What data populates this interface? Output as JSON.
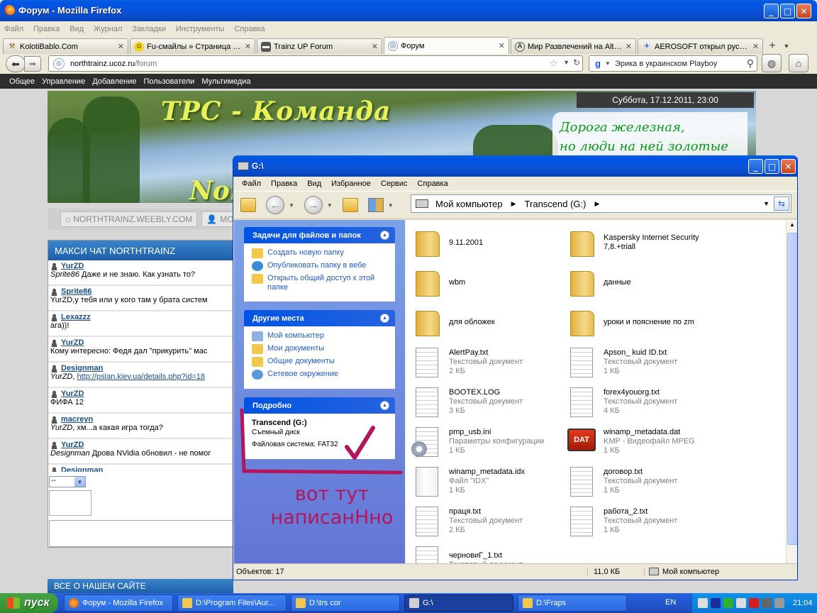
{
  "firefox": {
    "title": "Форум - Mozilla Firefox",
    "menu": [
      "Файл",
      "Правка",
      "Вид",
      "Журнал",
      "Закладки",
      "Инструменты",
      "Справка"
    ],
    "tabs": [
      {
        "label": "KolotiBablo.Com",
        "icon": "hammer-icon"
      },
      {
        "label": "Fu-смайлы » Страница 2 ...",
        "icon": "smiley-icon"
      },
      {
        "label": "Trainz UP Forum",
        "icon": "train-icon"
      },
      {
        "label": "Форум",
        "icon": "globe-icon",
        "active": true
      },
      {
        "label": "Мир Развлечений на AltF...",
        "icon": "a-icon"
      },
      {
        "label": "AEROSOFT открыл русск...",
        "icon": "plane-icon"
      }
    ],
    "url_host": "northtrainz.ucoz.ru",
    "url_path": "/forum",
    "search_value": "Эрика в украинском Playboy"
  },
  "site": {
    "menu": [
      "Общее",
      "Управление",
      "Добавление",
      "Пользователи",
      "Мультимедиа"
    ],
    "banner_title": "ТРС - Команда",
    "banner_north": "Nor",
    "banner_date": "Суббота, 17.12.2011, 23:00",
    "banner_slogan_1": "Дорога железная,",
    "banner_slogan_2": "но люди на ней золотые",
    "links": [
      "NORTHTRAINZ.WEEBLY.COM",
      "МОЙ"
    ],
    "chat_title": "МАКСИ ЧАТ NORTHTRAINZ",
    "chat": [
      {
        "user": "YurZD",
        "to": "Sprite86",
        "text": " Даже и не знаю. Как узнать то?"
      },
      {
        "user": "Sprite86",
        "to": "",
        "text": "YurZD,у тебя или у кого там у брата систем"
      },
      {
        "user": "Lexazzz",
        "to": "",
        "text": "ага))!"
      },
      {
        "user": "YurZD",
        "to": "",
        "text": "Кому интересно: Федя дал \"прикурить\" мас"
      },
      {
        "user": "Designman",
        "to": "YurZD",
        "text": ", ",
        "link": "http://pslan.kiev.ua/details.php?id=18"
      },
      {
        "user": "YurZD",
        "to": "",
        "text": "ФИФА 12"
      },
      {
        "user": "macreyn",
        "to": "YurZD",
        "text": ", хм...а какая игра тогда?"
      },
      {
        "user": "YurZD",
        "to": "Designman",
        "text": " Дрова NVidia обновил - не помог"
      },
      {
        "user": "Designman",
        "to": "",
        "text": ""
      }
    ],
    "chat_select": "--",
    "about": "ВСЕ О НАШЕМ САЙТЕ"
  },
  "explorer": {
    "title": "G:\\",
    "menu": [
      "Файл",
      "Правка",
      "Вид",
      "Избранное",
      "Сервис",
      "Справка"
    ],
    "address": [
      "Мой компьютер",
      "Transcend (G:)"
    ],
    "tasks_title": "Задачи для файлов и папок",
    "tasks": [
      "Создать новую папку",
      "Опубликовать папку в вебе",
      "Открыть общий доступ к этой папке"
    ],
    "places_title": "Другие места",
    "places": [
      "Мой компьютер",
      "Мои документы",
      "Общие документы",
      "Сетевое окружение"
    ],
    "details_title": "Подробно",
    "details_name": "Transcend (G:)",
    "details_type": "Съемный диск",
    "details_fs": "Файловая система: FAT32",
    "files": [
      {
        "name": "9.11.2001",
        "type": "",
        "size": "",
        "icon": "folder"
      },
      {
        "name": "Kaspersky Internet Security",
        "type": "7,8.+triall",
        "size": "",
        "icon": "folder"
      },
      {
        "name": "wbm",
        "type": "",
        "size": "",
        "icon": "folder"
      },
      {
        "name": "данные",
        "type": "",
        "size": "",
        "icon": "folder"
      },
      {
        "name": "для обложек",
        "type": "",
        "size": "",
        "icon": "folder"
      },
      {
        "name": "уроки и пояснение по zm",
        "type": "",
        "size": "",
        "icon": "folder"
      },
      {
        "name": "AlertPay.txt",
        "type": "Текстовый документ",
        "size": "2 КБ",
        "icon": "text-doc"
      },
      {
        "name": "Apson_ kuid ID.txt",
        "type": "Текстовый документ",
        "size": "1 КБ",
        "icon": "text-doc"
      },
      {
        "name": "BOOTEX.LOG",
        "type": "Текстовый документ",
        "size": "3 КБ",
        "icon": "text-doc"
      },
      {
        "name": "forex4youorg.txt",
        "type": "Текстовый документ",
        "size": "4 КБ",
        "icon": "text-doc"
      },
      {
        "name": "pmp_usb.ini",
        "type": "Параметры конфигурации",
        "size": "1 КБ",
        "icon": "ini-doc"
      },
      {
        "name": "winamp_metadata.dat",
        "type": "KMP - Видеофайл MPEG",
        "size": "1 КБ",
        "icon": "dat-file"
      },
      {
        "name": "winamp_metadata.idx",
        "type": "Файл \"IDX\"",
        "size": "1 КБ",
        "icon": "blank-doc"
      },
      {
        "name": "договор.txt",
        "type": "Текстовый документ",
        "size": "1 КБ",
        "icon": "text-doc"
      },
      {
        "name": "праця.txt",
        "type": "Текстовый документ",
        "size": "2 КБ",
        "icon": "text-doc"
      },
      {
        "name": "работа_2.txt",
        "type": "Текстовый документ",
        "size": "1 КБ",
        "icon": "text-doc"
      },
      {
        "name": "черновиГ_1.txt",
        "type": "Текстовый документ",
        "size": "",
        "icon": "text-doc"
      }
    ],
    "status_objects": "Объектов: 17",
    "status_size": "11,0 КБ",
    "status_location": "Мой компьютер",
    "dat_label": "DAT"
  },
  "annotation": {
    "line1": "вот тут",
    "line2": "написанНно",
    "color": "#b3165b"
  },
  "taskbar": {
    "start": "пуск",
    "buttons": [
      {
        "label": "Форум - Mozilla Firefox",
        "icon": "firefox-icon"
      },
      {
        "label": "D:\\Program Files\\Aur...",
        "icon": "folder-icon"
      },
      {
        "label": "D:\\trs cor",
        "icon": "folder-icon"
      },
      {
        "label": "G:\\",
        "icon": "drive-icon",
        "active": true
      },
      {
        "label": "D:\\Fraps",
        "icon": "folder-icon"
      }
    ],
    "lang": "EN",
    "clock": "21:04"
  }
}
